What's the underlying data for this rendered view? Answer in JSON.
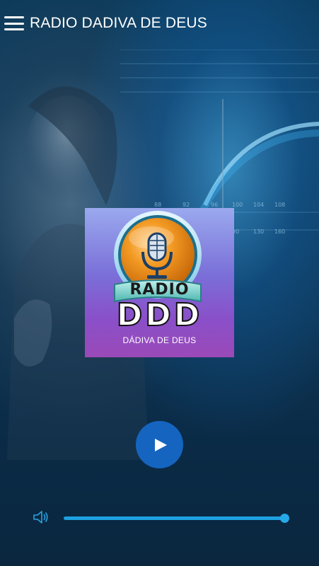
{
  "app": {
    "title": "RADIO DADIVA DE DEUS"
  },
  "header": {
    "menu_icon": "hamburger-menu-icon"
  },
  "background": {
    "dial_numbers_top": [
      "88",
      "92",
      "96",
      "100",
      "104",
      "108"
    ],
    "dial_numbers_bottom": [
      "90",
      "130",
      "160"
    ]
  },
  "logo": {
    "icon": "microphone-icon",
    "radio_label": "RADIO",
    "ddd_label": "DDD",
    "subtitle": "DÁDIVA DE DEUS"
  },
  "player": {
    "play_icon": "play-icon",
    "state": "stopped"
  },
  "volume": {
    "icon": "speaker-icon",
    "level": 1.0
  },
  "colors": {
    "accent": "#1565c0",
    "slider": "#1ea0e0",
    "background": "#0e3554"
  }
}
